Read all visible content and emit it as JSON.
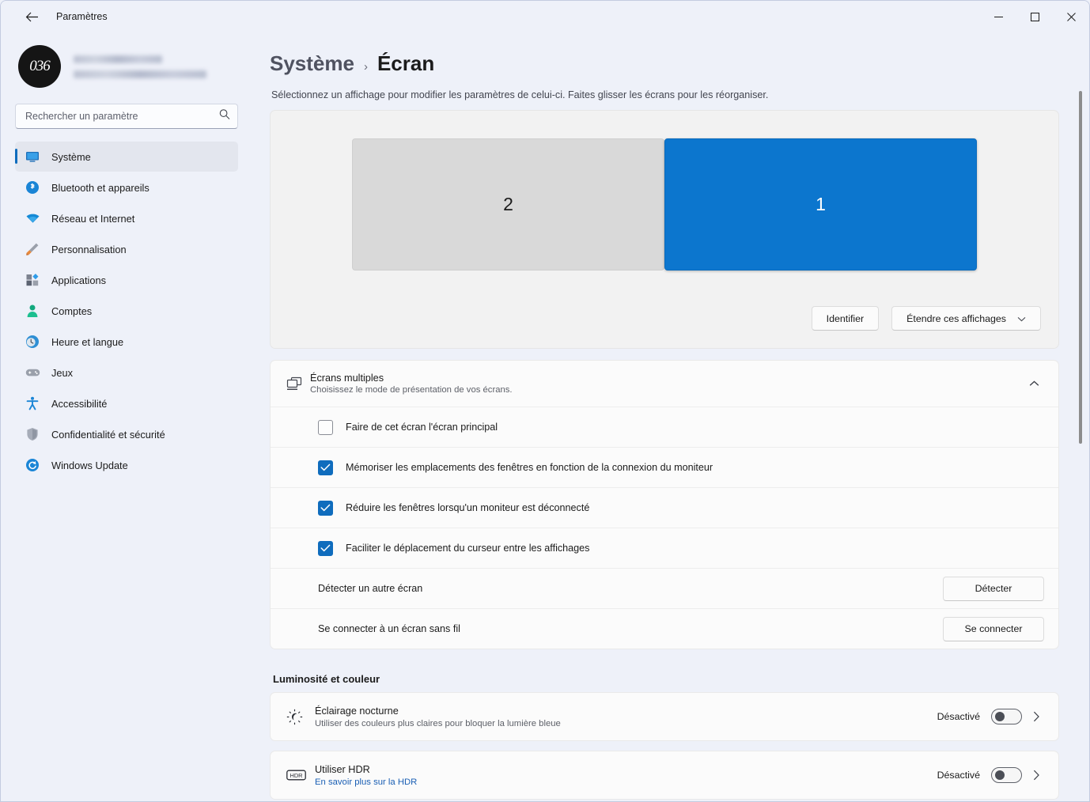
{
  "window": {
    "title": "Paramètres",
    "back_icon": "arrow-left-icon",
    "controls": {
      "minimize": "minimize-icon",
      "maximize": "maximize-icon",
      "close": "close-icon"
    }
  },
  "sidebar": {
    "account": {
      "avatar_text": "036",
      "name_redacted": "",
      "email_redacted": ""
    },
    "search": {
      "placeholder": "Rechercher un paramètre",
      "value": "",
      "icon": "search-icon"
    },
    "items": [
      {
        "label": "Système",
        "icon": "monitor-icon",
        "active": true
      },
      {
        "label": "Bluetooth et appareils",
        "icon": "bluetooth-icon",
        "active": false
      },
      {
        "label": "Réseau et Internet",
        "icon": "wifi-icon",
        "active": false
      },
      {
        "label": "Personnalisation",
        "icon": "paintbrush-icon",
        "active": false
      },
      {
        "label": "Applications",
        "icon": "apps-grid-icon",
        "active": false
      },
      {
        "label": "Comptes",
        "icon": "person-icon",
        "active": false
      },
      {
        "label": "Heure et langue",
        "icon": "clock-globe-icon",
        "active": false
      },
      {
        "label": "Jeux",
        "icon": "gamepad-icon",
        "active": false
      },
      {
        "label": "Accessibilité",
        "icon": "accessibility-icon",
        "active": false
      },
      {
        "label": "Confidentialité et sécurité",
        "icon": "shield-icon",
        "active": false
      },
      {
        "label": "Windows Update",
        "icon": "refresh-icon",
        "active": false
      }
    ]
  },
  "main": {
    "breadcrumb": {
      "parent": "Système",
      "separator": "›",
      "current": "Écran"
    },
    "subtitle": "Sélectionnez un affichage pour modifier les paramètres de celui-ci. Faites glisser les écrans pour les réorganiser.",
    "arrangement": {
      "monitors": [
        {
          "number": "2",
          "selected": false,
          "color": "#d9d9d9"
        },
        {
          "number": "1",
          "selected": true,
          "color": "#0c76ce"
        }
      ],
      "identify_button": "Identifier",
      "mode_dropdown": {
        "value": "Étendre ces affichages",
        "icon": "chevron-down-icon"
      }
    },
    "multiple_displays": {
      "icon": "dual-monitor-icon",
      "title": "Écrans multiples",
      "subtitle": "Choisissez le mode de présentation de vos écrans.",
      "expanded": true,
      "collapse_icon": "chevron-up-icon",
      "checkboxes": [
        {
          "label": "Faire de cet écran l'écran principal",
          "checked": false
        },
        {
          "label": "Mémoriser les emplacements des fenêtres en fonction de la connexion du moniteur",
          "checked": true
        },
        {
          "label": "Réduire les fenêtres lorsqu'un moniteur est déconnecté",
          "checked": true
        },
        {
          "label": "Faciliter le déplacement du curseur entre les affichages",
          "checked": true
        }
      ],
      "action_rows": [
        {
          "label": "Détecter un autre écran",
          "button": "Détecter"
        },
        {
          "label": "Se connecter à un écran sans fil",
          "button": "Se connecter"
        }
      ]
    },
    "brightness_section": {
      "heading": "Luminosité et couleur",
      "cards": [
        {
          "icon": "night-light-icon",
          "title": "Éclairage nocturne",
          "subtitle": "Utiliser des couleurs plus claires pour bloquer la lumière bleue",
          "link": "",
          "toggle_state": "Désactivé",
          "toggle_on": false,
          "chevron": "chevron-right-icon"
        },
        {
          "icon": "hdr-icon",
          "title": "Utiliser HDR",
          "subtitle": "",
          "link": "En savoir plus sur la HDR",
          "toggle_state": "Désactivé",
          "toggle_on": false,
          "chevron": "chevron-right-icon"
        }
      ]
    }
  },
  "colors": {
    "accent": "#0f6cbd",
    "selected_monitor": "#0c76ce",
    "sidebar_bg": "#eef1f9",
    "card_bg": "#fbfbfb",
    "link": "#1a5fb4"
  }
}
